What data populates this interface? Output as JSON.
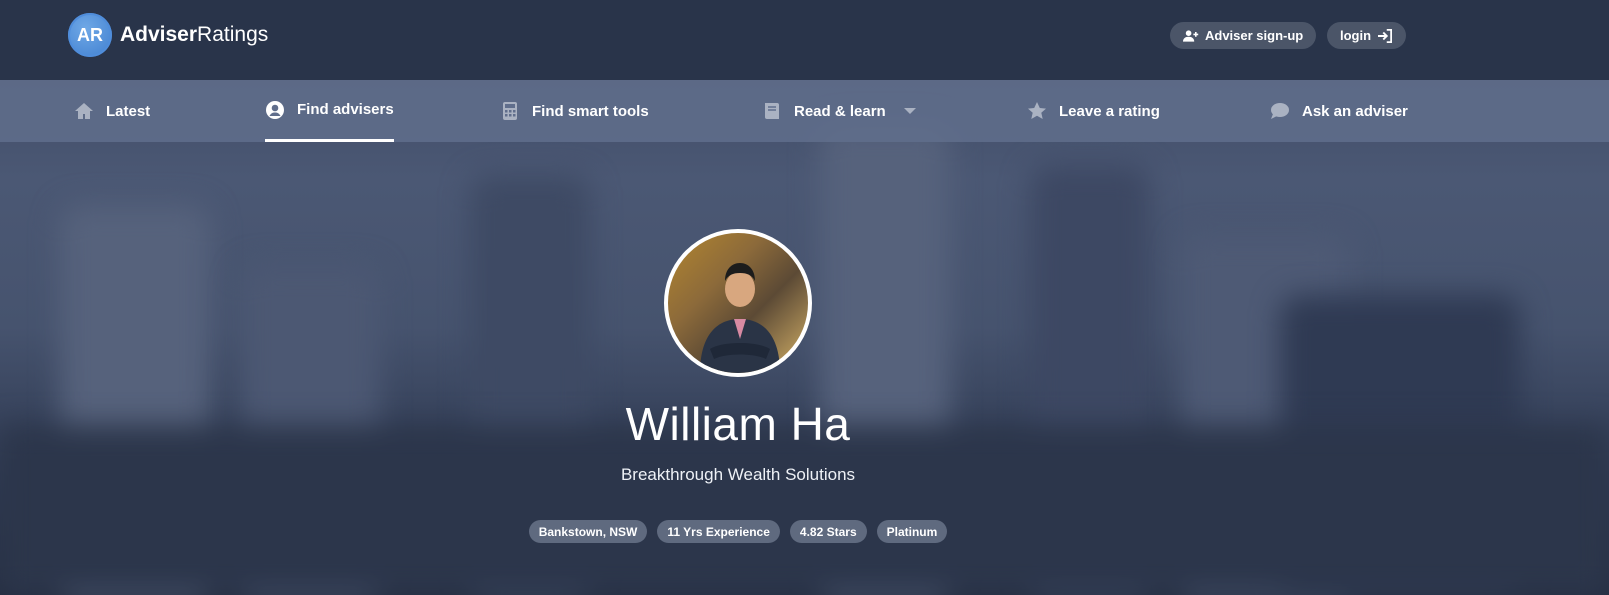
{
  "header": {
    "logo_initials": "AR",
    "logo_word_bold": "Adviser",
    "logo_word_light": "Ratings",
    "signup_label": "Adviser sign-up",
    "login_label": "login"
  },
  "nav": {
    "items": [
      {
        "label": "Latest",
        "icon": "home-icon"
      },
      {
        "label": "Find advisers",
        "icon": "user-circle-icon"
      },
      {
        "label": "Find smart tools",
        "icon": "calculator-icon"
      },
      {
        "label": "Read & learn",
        "icon": "book-icon"
      },
      {
        "label": "Leave a rating",
        "icon": "star-icon"
      },
      {
        "label": "Ask an adviser",
        "icon": "chat-bubble-icon"
      }
    ],
    "active": "Find advisers"
  },
  "profile": {
    "name": "William Ha",
    "company": "Breakthrough Wealth Solutions",
    "badges": [
      "Bankstown, NSW",
      "11 Yrs Experience",
      "4.82 Stars",
      "Platinum"
    ]
  },
  "colors": {
    "topbar": "#29344a",
    "navbar": "#606e8c",
    "accent": "#3f7fd0",
    "pill": "#4b5568"
  }
}
